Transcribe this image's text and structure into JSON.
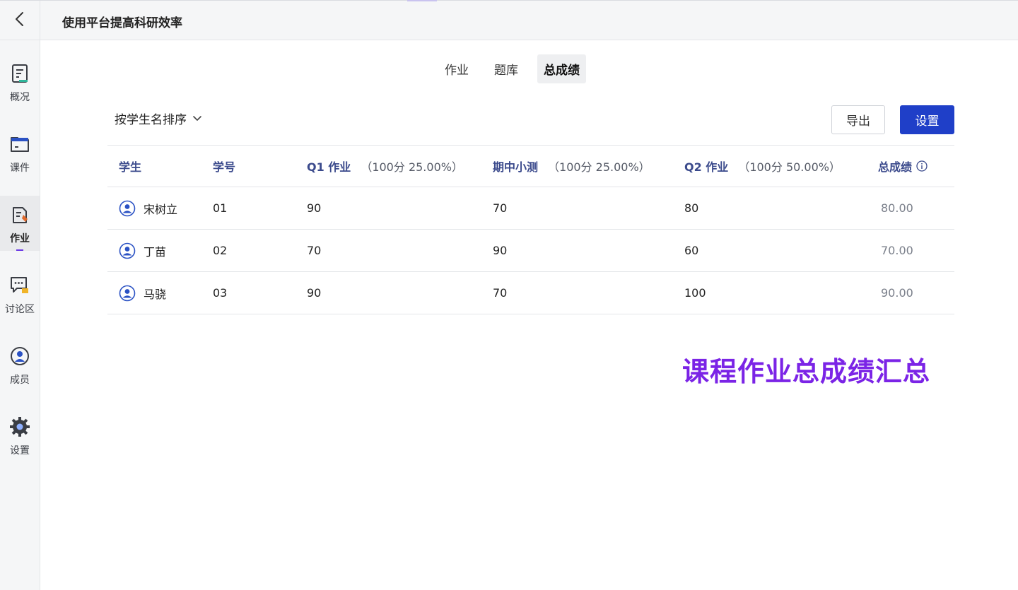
{
  "header": {
    "title": "使用平台提高科研效率",
    "back_icon": "chevron-left-icon"
  },
  "sidebar": {
    "items": [
      {
        "label": "概况",
        "icon": "overview-doc-icon"
      },
      {
        "label": "课件",
        "icon": "folder-icon"
      },
      {
        "label": "作业",
        "icon": "homework-edit-icon",
        "active": true
      },
      {
        "label": "讨论区",
        "icon": "chat-bubble-icon"
      },
      {
        "label": "成员",
        "icon": "member-person-icon"
      },
      {
        "label": "设置",
        "icon": "gear-icon"
      }
    ]
  },
  "tabs": [
    {
      "label": "作业"
    },
    {
      "label": "题库"
    },
    {
      "label": "总成绩",
      "active": true
    }
  ],
  "toolbar": {
    "sort_label": "按学生名排序",
    "export_label": "导出",
    "settings_label": "设置"
  },
  "table": {
    "columns": [
      {
        "main": "学生",
        "sub": ""
      },
      {
        "main": "学号",
        "sub": ""
      },
      {
        "main": "Q1 作业",
        "sub": "（100分 25.00%）"
      },
      {
        "main": "期中小测",
        "sub": "（100分 25.00%）"
      },
      {
        "main": "Q2 作业",
        "sub": "（100分 50.00%）"
      },
      {
        "main": "总成绩",
        "sub": ""
      }
    ],
    "rows": [
      {
        "name": "宋树立",
        "id": "01",
        "q1": "90",
        "mid": "70",
        "q2": "80",
        "total": "80.00"
      },
      {
        "name": "丁苗",
        "id": "02",
        "q1": "70",
        "mid": "90",
        "q2": "60",
        "total": "70.00"
      },
      {
        "name": "马骁",
        "id": "03",
        "q1": "90",
        "mid": "70",
        "q2": "100",
        "total": "90.00"
      }
    ]
  },
  "caption": "课程作业总成绩汇总",
  "colors": {
    "primary": "#1f3fc8",
    "accent": "#6a38e6",
    "caption": "#7b24e6",
    "header_text": "#3b4a8c"
  }
}
